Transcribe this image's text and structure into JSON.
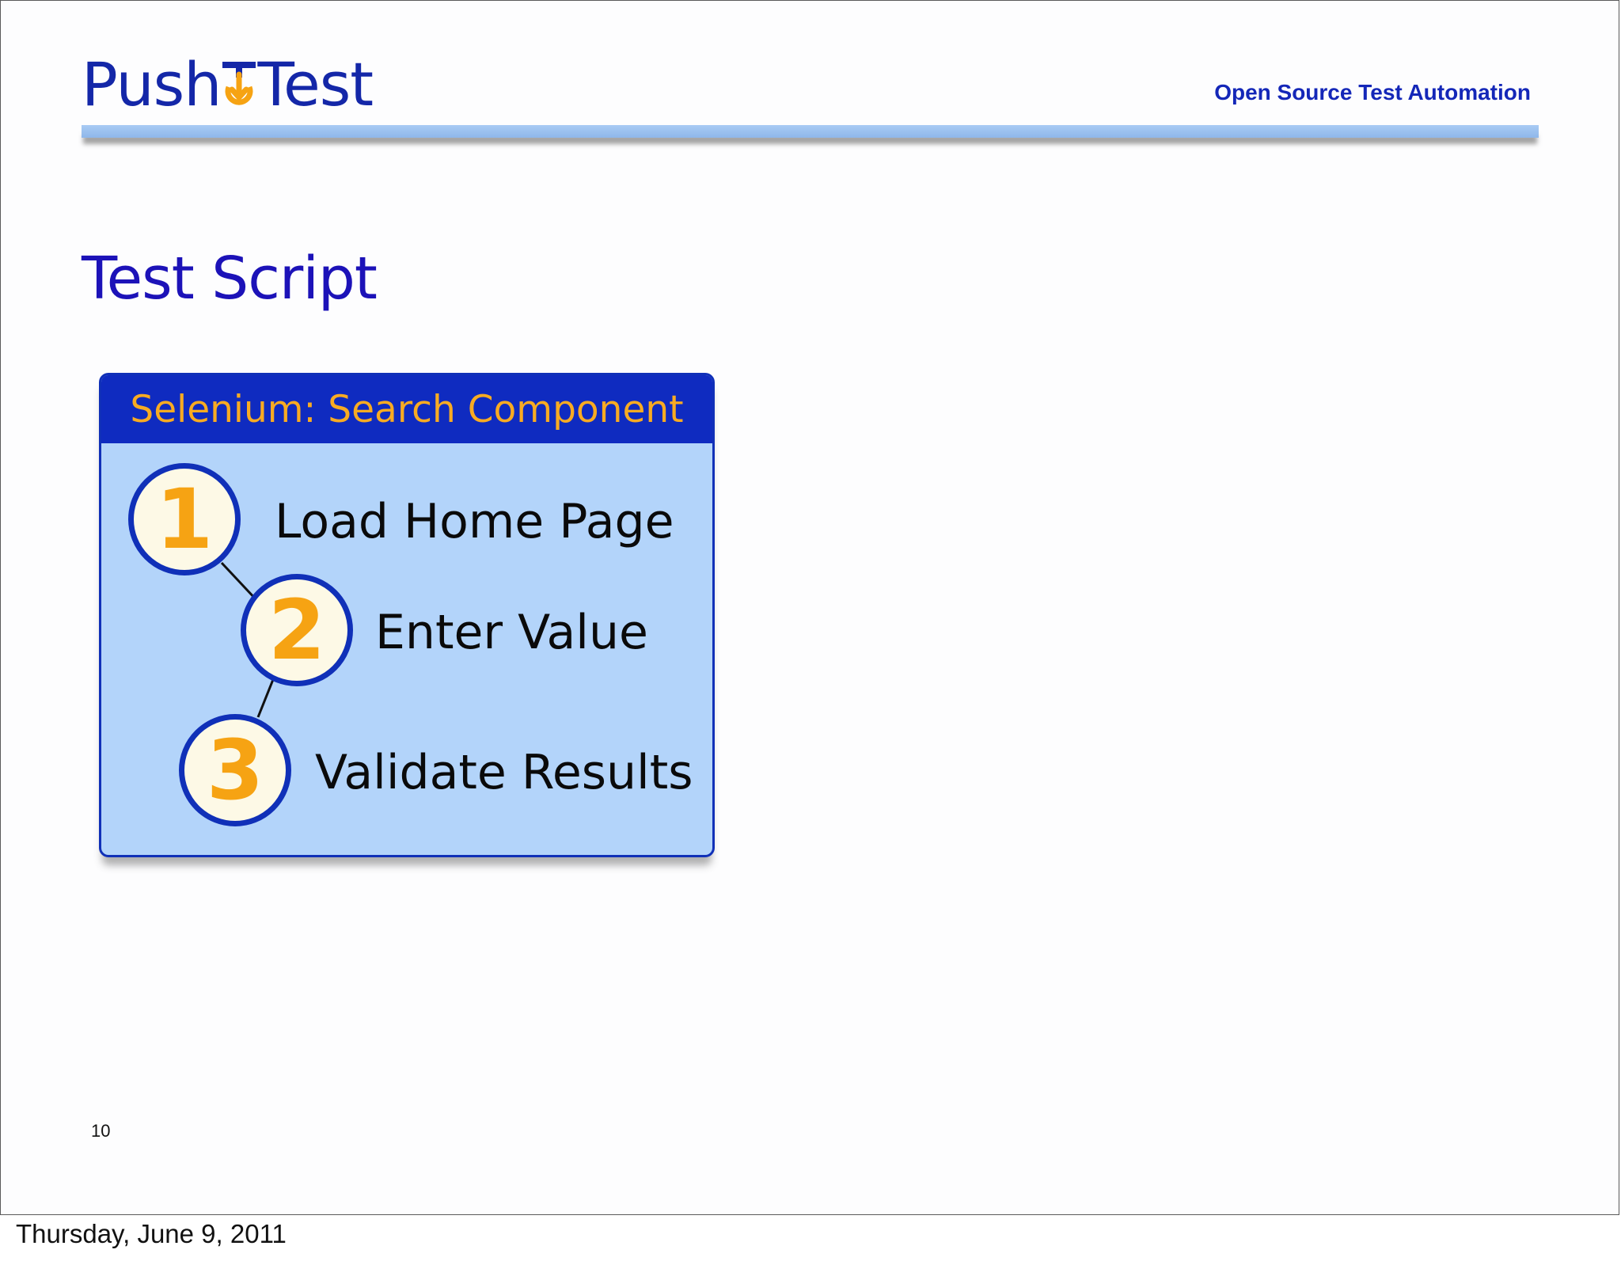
{
  "header": {
    "logo": {
      "part1": "Push",
      "part2": "Test"
    },
    "tagline": "Open Source Test Automation"
  },
  "slide": {
    "title": "Test Script",
    "panel": {
      "heading": "Selenium: Search Component",
      "steps": [
        {
          "number": "1",
          "label": "Load Home Page"
        },
        {
          "number": "2",
          "label": "Enter Value"
        },
        {
          "number": "3",
          "label": "Validate Results"
        }
      ]
    },
    "page_number": "10"
  },
  "footer": {
    "date": "Thursday, June 9, 2011"
  },
  "colors": {
    "title_blue": "#1c12b8",
    "panel_header_blue": "#0f2bc0",
    "panel_fill": "#b3d4fa",
    "accent_orange": "#f6a313"
  }
}
